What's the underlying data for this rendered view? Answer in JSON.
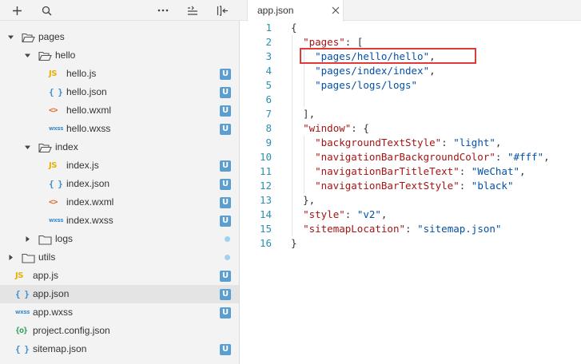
{
  "toolbar": {
    "icons": [
      "plus-icon",
      "search-icon",
      "more-icon",
      "collapse-all-icon",
      "toggle-sidebar-icon"
    ]
  },
  "tree": [
    {
      "label": "pages",
      "type": "folder",
      "expanded": true,
      "depth": 0
    },
    {
      "label": "hello",
      "type": "folder",
      "expanded": true,
      "depth": 1
    },
    {
      "label": "hello.js",
      "type": "js",
      "depth": 2,
      "icon_text": "JS",
      "badge": "U"
    },
    {
      "label": "hello.json",
      "type": "json",
      "depth": 2,
      "icon_text": "{ }",
      "badge": "U"
    },
    {
      "label": "hello.wxml",
      "type": "wxml",
      "depth": 2,
      "icon_text": "<>",
      "badge": "U"
    },
    {
      "label": "hello.wxss",
      "type": "wxss",
      "depth": 2,
      "icon_text": "wxss",
      "badge": "U"
    },
    {
      "label": "index",
      "type": "folder",
      "expanded": true,
      "depth": 1
    },
    {
      "label": "index.js",
      "type": "js",
      "depth": 2,
      "icon_text": "JS",
      "badge": "U"
    },
    {
      "label": "index.json",
      "type": "json",
      "depth": 2,
      "icon_text": "{ }",
      "badge": "U"
    },
    {
      "label": "index.wxml",
      "type": "wxml",
      "depth": 2,
      "icon_text": "<>",
      "badge": "U"
    },
    {
      "label": "index.wxss",
      "type": "wxss",
      "depth": 2,
      "icon_text": "wxss",
      "badge": "U"
    },
    {
      "label": "logs",
      "type": "folder",
      "expanded": false,
      "depth": 1,
      "dot": true
    },
    {
      "label": "utils",
      "type": "folder",
      "expanded": false,
      "depth": 0,
      "dot": true
    },
    {
      "label": "app.js",
      "type": "js",
      "depth": 0,
      "icon_text": "JS",
      "badge": "U"
    },
    {
      "label": "app.json",
      "type": "json",
      "depth": 0,
      "icon_text": "{ }",
      "badge": "U",
      "selected": true
    },
    {
      "label": "app.wxss",
      "type": "wxss",
      "depth": 0,
      "icon_text": "wxss",
      "badge": "U"
    },
    {
      "label": "project.config.json",
      "type": "config",
      "depth": 0,
      "icon_text": "{o}"
    },
    {
      "label": "sitemap.json",
      "type": "json",
      "depth": 0,
      "icon_text": "{ }",
      "badge": "U"
    }
  ],
  "editor": {
    "tab_label": "app.json",
    "close_glyph": "×",
    "lines": [
      {
        "n": "1",
        "tokens": [
          [
            "p",
            "{"
          ]
        ]
      },
      {
        "n": "2",
        "tokens": [
          [
            "p",
            "  "
          ],
          [
            "k",
            "\"pages\""
          ],
          [
            "p",
            ": ["
          ]
        ]
      },
      {
        "n": "3",
        "tokens": [
          [
            "p",
            "    "
          ],
          [
            "s",
            "\"pages/hello/hello\""
          ],
          [
            "p",
            ","
          ]
        ]
      },
      {
        "n": "4",
        "tokens": [
          [
            "p",
            "    "
          ],
          [
            "s",
            "\"pages/index/index\""
          ],
          [
            "p",
            ","
          ]
        ]
      },
      {
        "n": "5",
        "tokens": [
          [
            "p",
            "    "
          ],
          [
            "s",
            "\"pages/logs/logs\""
          ]
        ]
      },
      {
        "n": "6",
        "tokens": [
          [
            "p",
            ""
          ]
        ]
      },
      {
        "n": "7",
        "tokens": [
          [
            "p",
            "  ],"
          ]
        ]
      },
      {
        "n": "8",
        "tokens": [
          [
            "p",
            "  "
          ],
          [
            "k",
            "\"window\""
          ],
          [
            "p",
            ": {"
          ]
        ]
      },
      {
        "n": "9",
        "tokens": [
          [
            "p",
            "    "
          ],
          [
            "k",
            "\"backgroundTextStyle\""
          ],
          [
            "p",
            ": "
          ],
          [
            "s",
            "\"light\""
          ],
          [
            "p",
            ","
          ]
        ]
      },
      {
        "n": "10",
        "tokens": [
          [
            "p",
            "    "
          ],
          [
            "k",
            "\"navigationBarBackgroundColor\""
          ],
          [
            "p",
            ": "
          ],
          [
            "s",
            "\"#fff\""
          ],
          [
            "p",
            ","
          ]
        ]
      },
      {
        "n": "11",
        "tokens": [
          [
            "p",
            "    "
          ],
          [
            "k",
            "\"navigationBarTitleText\""
          ],
          [
            "p",
            ": "
          ],
          [
            "s",
            "\"WeChat\""
          ],
          [
            "p",
            ","
          ]
        ]
      },
      {
        "n": "12",
        "tokens": [
          [
            "p",
            "    "
          ],
          [
            "k",
            "\"navigationBarTextStyle\""
          ],
          [
            "p",
            ": "
          ],
          [
            "s",
            "\"black\""
          ]
        ]
      },
      {
        "n": "13",
        "tokens": [
          [
            "p",
            "  },"
          ]
        ]
      },
      {
        "n": "14",
        "tokens": [
          [
            "p",
            "  "
          ],
          [
            "k",
            "\"style\""
          ],
          [
            "p",
            ": "
          ],
          [
            "s",
            "\"v2\""
          ],
          [
            "p",
            ","
          ]
        ]
      },
      {
        "n": "15",
        "tokens": [
          [
            "p",
            "  "
          ],
          [
            "k",
            "\"sitemapLocation\""
          ],
          [
            "p",
            ": "
          ],
          [
            "s",
            "\"sitemap.json\""
          ]
        ]
      },
      {
        "n": "16",
        "tokens": [
          [
            "p",
            "}"
          ]
        ]
      }
    ]
  },
  "colors": {
    "badge": "#5a9fd0",
    "dot": "#9fd2f0",
    "highlight": "#e03a3a",
    "json_key": "#a31515",
    "json_string": "#0451a5",
    "line_number": "#2b91af"
  }
}
